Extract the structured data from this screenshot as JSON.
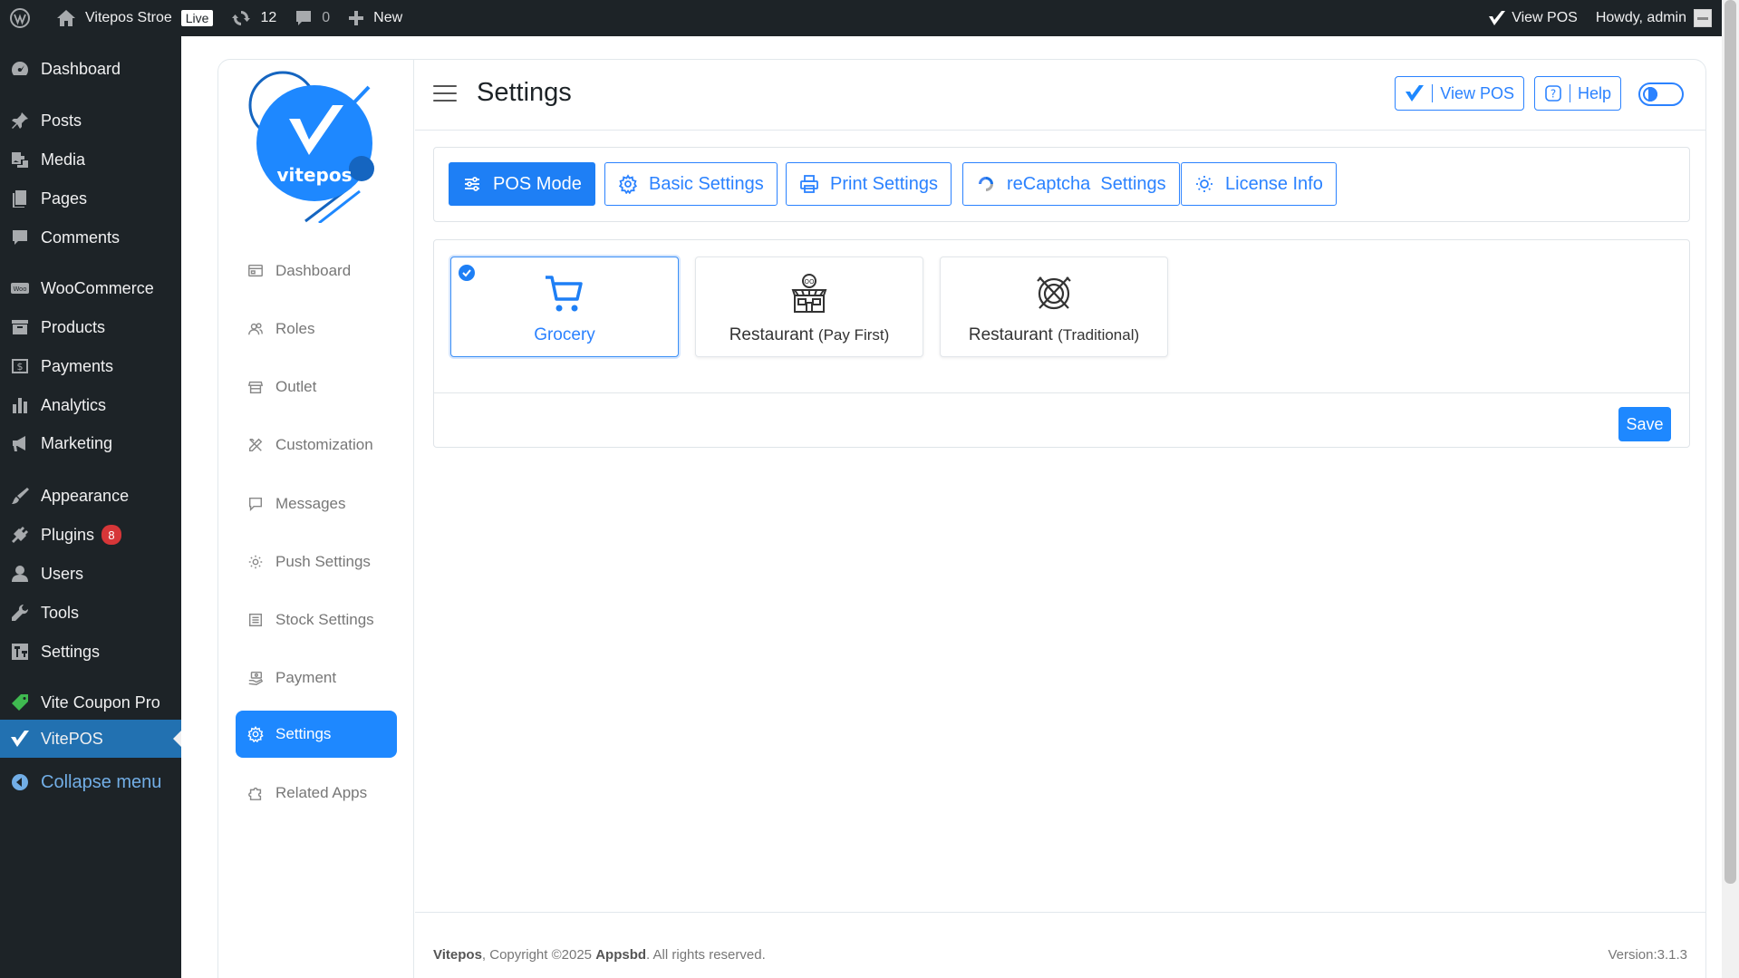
{
  "adminbar": {
    "site_name": "Vitepos Stroe",
    "live_badge": "Live",
    "updates_count": "12",
    "comments_count": "0",
    "new_label": "New",
    "view_pos": "View POS",
    "howdy": "Howdy, admin"
  },
  "wp_menu": {
    "dashboard": "Dashboard",
    "posts": "Posts",
    "media": "Media",
    "pages": "Pages",
    "comments": "Comments",
    "woocommerce": "WooCommerce",
    "products": "Products",
    "payments": "Payments",
    "analytics": "Analytics",
    "marketing": "Marketing",
    "appearance": "Appearance",
    "plugins": "Plugins",
    "plugins_badge": "8",
    "users": "Users",
    "tools": "Tools",
    "settings": "Settings",
    "vite_coupon": "Vite Coupon Pro",
    "vitepos": "VitePOS",
    "collapse": "Collapse menu"
  },
  "plugin_nav": {
    "logo_text": "vitepos",
    "dashboard": "Dashboard",
    "roles": "Roles",
    "outlet": "Outlet",
    "customization": "Customization",
    "messages": "Messages",
    "push_settings": "Push Settings",
    "stock_settings": "Stock Settings",
    "payment": "Payment",
    "settings": "Settings",
    "related_apps": "Related Apps"
  },
  "header": {
    "title": "Settings",
    "view_pos": "View POS",
    "help": "Help"
  },
  "tabs": {
    "pos_mode": "POS Mode",
    "basic": "Basic Settings",
    "print": "Print Settings",
    "recaptcha": "reCaptcha  Settings",
    "license": "License Info"
  },
  "modes": {
    "grocery": "Grocery",
    "restaurant_pay_first": "Restaurant",
    "restaurant_pay_first_sub": "(Pay First)",
    "restaurant_traditional": "Restaurant",
    "restaurant_traditional_sub": "(Traditional)",
    "save": "Save"
  },
  "footer": {
    "brand": "Vitepos",
    "copyright": ", Copyright ©2025 ",
    "company": "Appsbd",
    "rights": ". All rights reserved.",
    "version": "Version:3.1.3"
  },
  "colors": {
    "accent": "#1e88ff",
    "wp_dark": "#1d2327",
    "wp_blue": "#2271b1"
  }
}
